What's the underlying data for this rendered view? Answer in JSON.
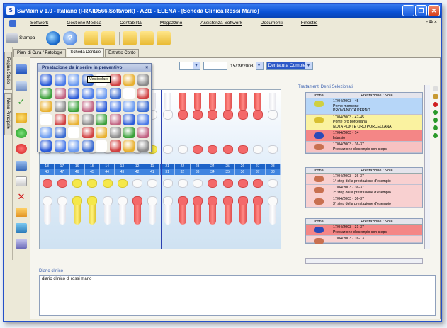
{
  "window": {
    "title": "SwMain v 1.0 - Italiano (I-RAID566.Softwork) - AZI1 - ELENA - [Scheda Clinica Rossi Mario]"
  },
  "menu": {
    "items": [
      "Softwork",
      "Gestione Medica",
      "Contabilità",
      "Magazzino",
      "Assistenza Softwork",
      "Documenti",
      "Finestre"
    ],
    "mdi": "- ⧉ ×"
  },
  "toolbar": {
    "stampa_label": "Stampa"
  },
  "tabs": [
    "Piani di Cura / Patologie",
    "Scheda Dentale",
    "Estratto Conto"
  ],
  "side_tabs": [
    "Pagina Studio",
    "Menu Principale"
  ],
  "filters": {
    "date": "15/09/2003",
    "dentatura": "Dentatura Completa"
  },
  "palette": {
    "title": "Prestazione da inserire in preventivo",
    "tooltip": "Vestibolare"
  },
  "numbers": {
    "top": [
      "18",
      "17",
      "16",
      "15",
      "14",
      "13",
      "12",
      "11",
      "21",
      "22",
      "23",
      "24",
      "25",
      "26",
      "27",
      "28"
    ],
    "bottom": [
      "48",
      "47",
      "46",
      "45",
      "44",
      "43",
      "42",
      "41",
      "31",
      "32",
      "33",
      "34",
      "35",
      "36",
      "37",
      "38"
    ]
  },
  "right_panel": {
    "title": "Trattamenti Denti Selezionati",
    "col_icona": "Icona",
    "col_prest": "Prestazione / Note",
    "group1": [
      {
        "lines": [
          "17/04/2003 - 45",
          "Perno moncone",
          "PROVA NOTA PERNO"
        ],
        "color": "blue"
      },
      {
        "lines": [
          "17/04/2003 - 47-45",
          "Ponte oro porcellana",
          "NOTA PONTE ORO PORCELLANA"
        ],
        "color": "yellow"
      },
      {
        "lines": [
          "17/04/2003 - 14",
          "Intarsio"
        ],
        "color": "red"
      },
      {
        "lines": [
          "17/04/2003 - 36-37",
          "Prestazione d'esempio con steps"
        ],
        "color": "pink"
      }
    ],
    "group2": [
      {
        "lines": [
          "17/04/2003 - 36-37",
          "1° step della prestazione d'esempio"
        ],
        "color": "lpink"
      },
      {
        "lines": [
          "17/04/2003 - 36-37",
          "2° step della prestazione d'esempio"
        ],
        "color": "lpink"
      },
      {
        "lines": [
          "17/04/2003 - 36-37",
          "3° step della prestazione d'esempio"
        ],
        "color": "lpink"
      }
    ],
    "group3": [
      {
        "lines": [
          "17/04/2003 - 31-37",
          "Prestazione d'esempio con steps"
        ],
        "color": "red"
      },
      {
        "lines": [
          "17/04/2003 - 16-13"
        ],
        "color": "lpink"
      }
    ]
  },
  "diario": {
    "label": "Diario clinico",
    "text": "diario clinico di rossi mario"
  }
}
